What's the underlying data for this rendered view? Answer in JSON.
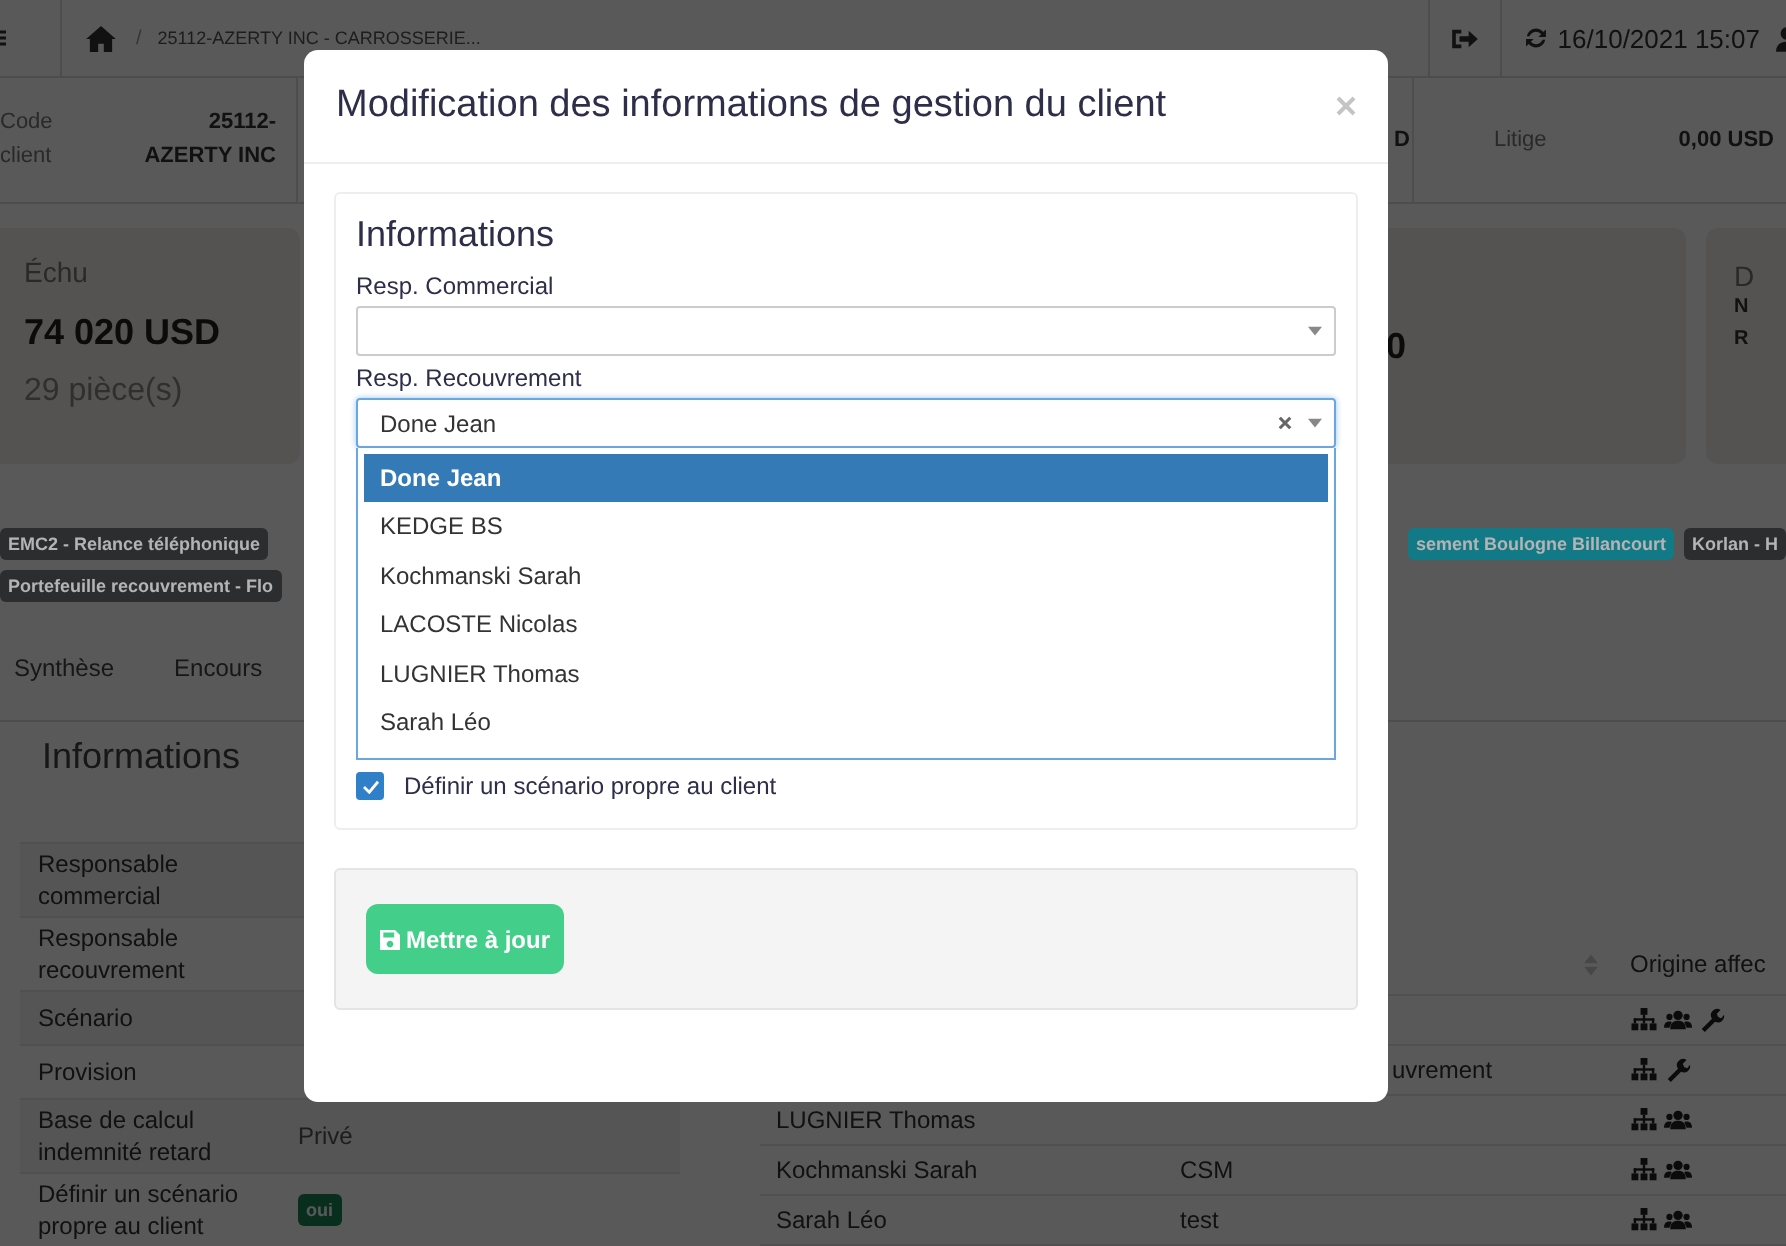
{
  "topbar": {
    "breadcrumb": "25112-AZERTY INC - CARROSSERIE...",
    "separator": "/",
    "datetime": "16/10/2021 15:07"
  },
  "summary": {
    "client_code": {
      "label": "Code client",
      "value": "25112- AZERTY INC"
    },
    "column_3_value": "D",
    "litige": {
      "label": "Litige",
      "value": "0,00 USD"
    }
  },
  "cards": {
    "echu": {
      "title": "Échu",
      "amount": "74 020 USD",
      "count": "29 pièce(s)"
    },
    "column_2_amount": "0",
    "column_3": {
      "title": "D",
      "lines": [
        "N",
        "R"
      ]
    }
  },
  "tag_rows": [
    {
      "left": [
        {
          "text": "EMC2 - Relance téléphonique",
          "color": "#2b2d2f"
        }
      ],
      "right": [
        {
          "text": "sement Boulogne Billancourt",
          "color": "#127a86"
        },
        {
          "text": "Korlan - H",
          "color": "#2b2d2f"
        }
      ]
    },
    {
      "left": [
        {
          "text": "Portefeuille recouvrement - Flo",
          "color": "#2b2d2f"
        }
      ],
      "right": []
    }
  ],
  "tabs": [
    "Synthèse",
    "Encours"
  ],
  "info_panel": {
    "title": "Informations",
    "rows": [
      {
        "label": "Responsable commercial",
        "kind": "text"
      },
      {
        "label": "Responsable recouvrement",
        "kind": "text"
      },
      {
        "label": "Scénario",
        "kind": "text"
      },
      {
        "label": "Provision",
        "kind": "text"
      },
      {
        "label": "Base de calcul indemnité retard",
        "kind": "text",
        "value": "Privé"
      },
      {
        "label": "Définir un scénario propre au client",
        "kind": "badge",
        "value": "oui"
      }
    ]
  },
  "assign_table": {
    "column_3_header": "Origine affec",
    "rows": [
      {
        "from_hierarchy": true,
        "from_team": true,
        "manual": true
      },
      {
        "column_2_covered": "uvrement",
        "from_hierarchy": true,
        "from_team": false,
        "manual": true
      },
      {
        "column_1": "LUGNIER Thomas",
        "from_hierarchy": true,
        "from_team": true,
        "manual": false
      },
      {
        "column_1": "Kochmanski Sarah",
        "column_2": "CSM",
        "from_hierarchy": true,
        "from_team": true,
        "manual": false
      },
      {
        "column_1": "Sarah Léo",
        "column_2": "test",
        "from_hierarchy": true,
        "from_team": true,
        "manual": false
      }
    ]
  },
  "modal": {
    "title": "Modification des informations de gestion du client",
    "section_title": "Informations",
    "resp_commercial": {
      "label": "Resp. Commercial"
    },
    "resp_recouvrement": {
      "label": "Resp. Recouvrement",
      "value": "Done Jean",
      "open": true,
      "options": [
        {
          "label": "Done Jean",
          "selected": true
        },
        {
          "label": "KEDGE BS",
          "selected": false
        },
        {
          "label": "Kochmanski Sarah",
          "selected": false
        },
        {
          "label": "LACOSTE Nicolas",
          "selected": false
        },
        {
          "label": "LUGNIER Thomas",
          "selected": false
        },
        {
          "label": "Sarah Léo",
          "selected": false
        }
      ]
    },
    "checkbox": {
      "label": "Définir un scénario propre au client",
      "checked": true
    },
    "submit": "Mettre à jour"
  }
}
